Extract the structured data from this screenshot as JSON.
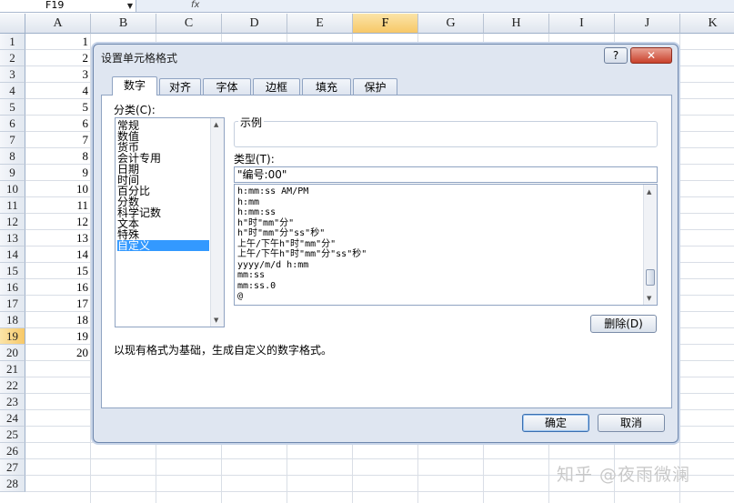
{
  "formula_bar": {
    "name_box": "F19",
    "fx_label": "fx"
  },
  "columns": [
    "A",
    "B",
    "C",
    "D",
    "E",
    "F",
    "G",
    "H",
    "I",
    "J",
    "K"
  ],
  "selected_column": "F",
  "rows": [
    "1",
    "2",
    "3",
    "4",
    "5",
    "6",
    "7",
    "8",
    "9",
    "10",
    "11",
    "12",
    "13",
    "14",
    "15",
    "16",
    "17",
    "18",
    "19",
    "20",
    "21",
    "22",
    "23",
    "24",
    "25",
    "26",
    "27",
    "28"
  ],
  "selected_row": "19",
  "col_a_values": [
    "1",
    "2",
    "3",
    "4",
    "5",
    "6",
    "7",
    "8",
    "9",
    "10",
    "11",
    "12",
    "13",
    "14",
    "15",
    "16",
    "17",
    "18",
    "19",
    "20"
  ],
  "dialog": {
    "title": "设置单元格格式",
    "help_label": "?",
    "close_label": "✕",
    "tabs": [
      "数字",
      "对齐",
      "字体",
      "边框",
      "填充",
      "保护"
    ],
    "category_label": "分类(C):",
    "categories": [
      "常规",
      "数值",
      "货币",
      "会计专用",
      "日期",
      "时间",
      "百分比",
      "分数",
      "科学记数",
      "文本",
      "特殊",
      "自定义"
    ],
    "selected_category": "自定义",
    "sample_label": "示例",
    "type_label": "类型(T):",
    "type_value": "\"编号:00\"",
    "formats": [
      "h:mm:ss AM/PM",
      "h:mm",
      "h:mm:ss",
      "h\"时\"mm\"分\"",
      "h\"时\"mm\"分\"ss\"秒\"",
      "上午/下午h\"时\"mm\"分\"",
      "上午/下午h\"时\"mm\"分\"ss\"秒\"",
      "yyyy/m/d h:mm",
      "mm:ss",
      "mm:ss.0",
      "@"
    ],
    "delete_button": "删除(D)",
    "description": "以现有格式为基础，生成自定义的数字格式。",
    "ok_button": "确定",
    "cancel_button": "取消"
  },
  "watermark": "知乎 @夜雨微澜"
}
